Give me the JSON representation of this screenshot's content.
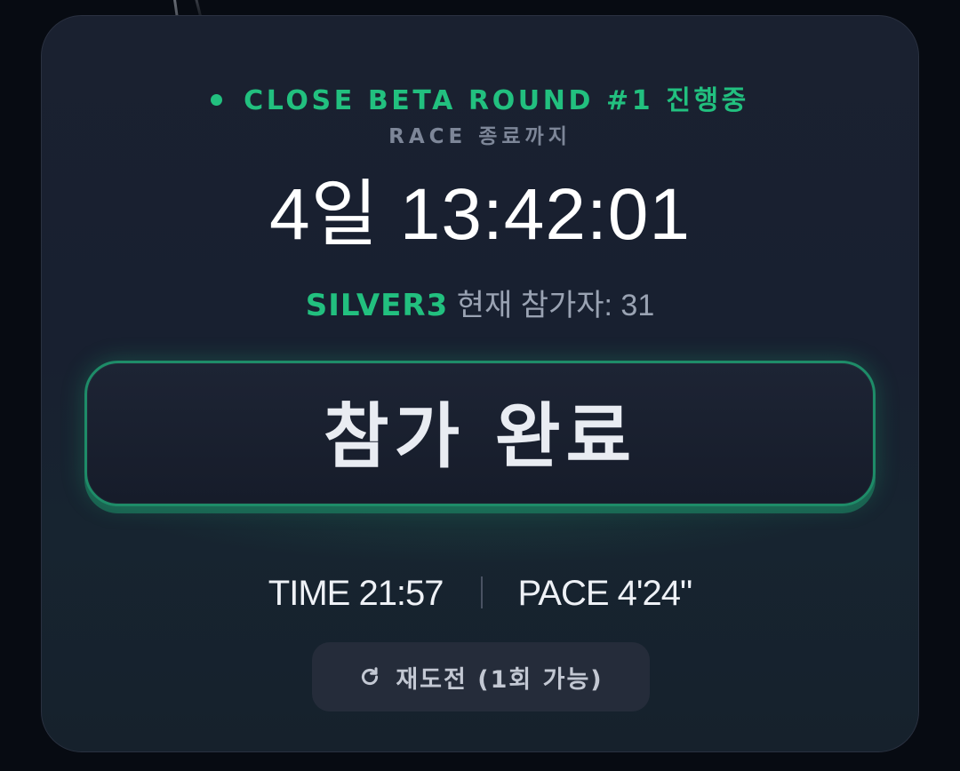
{
  "status": {
    "round_label": "CLOSE BETA ROUND #1 진행중",
    "race_label": "RACE 종료까지"
  },
  "countdown": {
    "value": "4일 13:42:01"
  },
  "participants": {
    "tier": "SILVER3",
    "label": "현재 참가자: 31"
  },
  "join_button": {
    "label": "참가 완료"
  },
  "stats": {
    "time": "TIME 21:57",
    "pace": "PACE 4'24\""
  },
  "retry_button": {
    "label": "재도전 (1회 가능)"
  },
  "colors": {
    "accent": "#22c07f",
    "card_background": "#1a2130",
    "page_background": "#070b12"
  },
  "icons": {
    "status": "status-dot-icon",
    "retry": "refresh-icon"
  }
}
